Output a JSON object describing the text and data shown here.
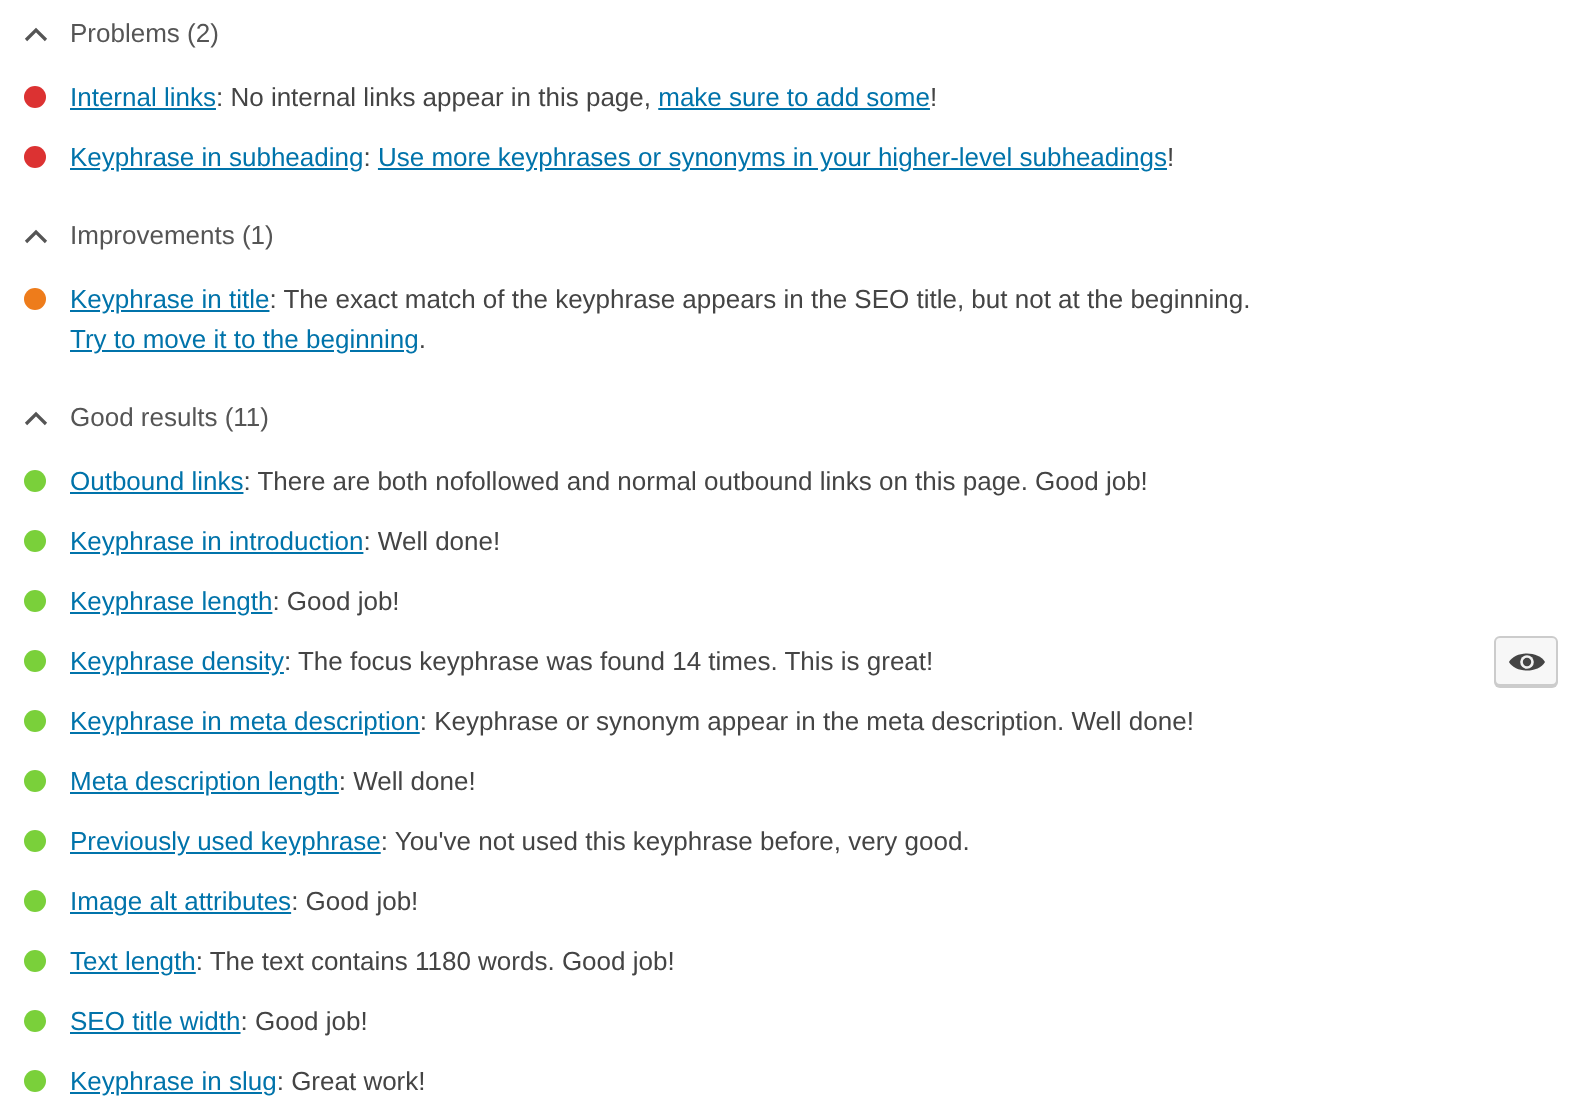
{
  "sections": [
    {
      "heading": "Problems (2)",
      "expanded": true,
      "items": [
        {
          "color": "#dc3232",
          "marker_button": false,
          "parts": [
            {
              "text": "Internal links",
              "link": true
            },
            {
              "text": ": No internal links appear in this page, ",
              "link": false
            },
            {
              "text": "make sure to add some",
              "link": true
            },
            {
              "text": "!",
              "link": false
            }
          ]
        },
        {
          "color": "#dc3232",
          "marker_button": false,
          "parts": [
            {
              "text": "Keyphrase in subheading",
              "link": true
            },
            {
              "text": ": ",
              "link": false
            },
            {
              "text": "Use more keyphrases or synonyms in your higher-level subheadings",
              "link": true
            },
            {
              "text": "!",
              "link": false
            }
          ]
        }
      ]
    },
    {
      "heading": "Improvements (1)",
      "expanded": true,
      "items": [
        {
          "color": "#ee7c1b",
          "marker_button": false,
          "parts": [
            {
              "text": "Keyphrase in title",
              "link": true
            },
            {
              "text": ": The exact match of the keyphrase appears in the SEO title, but not at the beginning. ",
              "link": false
            },
            {
              "text": "Try to move it to the beginning",
              "link": true
            },
            {
              "text": ".",
              "link": false
            }
          ]
        }
      ]
    },
    {
      "heading": "Good results (11)",
      "expanded": true,
      "items": [
        {
          "color": "#7ad03a",
          "marker_button": false,
          "parts": [
            {
              "text": "Outbound links",
              "link": true
            },
            {
              "text": ": There are both nofollowed and normal outbound links on this page. Good job!",
              "link": false
            }
          ]
        },
        {
          "color": "#7ad03a",
          "marker_button": false,
          "parts": [
            {
              "text": "Keyphrase in introduction",
              "link": true
            },
            {
              "text": ": Well done!",
              "link": false
            }
          ]
        },
        {
          "color": "#7ad03a",
          "marker_button": false,
          "parts": [
            {
              "text": "Keyphrase length",
              "link": true
            },
            {
              "text": ": Good job!",
              "link": false
            }
          ]
        },
        {
          "color": "#7ad03a",
          "marker_button": true,
          "parts": [
            {
              "text": "Keyphrase density",
              "link": true
            },
            {
              "text": ": The focus keyphrase was found 14 times. This is great!",
              "link": false
            }
          ]
        },
        {
          "color": "#7ad03a",
          "marker_button": false,
          "parts": [
            {
              "text": "Keyphrase in meta description",
              "link": true
            },
            {
              "text": ": Keyphrase or synonym appear in the meta description. Well done!",
              "link": false
            }
          ]
        },
        {
          "color": "#7ad03a",
          "marker_button": false,
          "parts": [
            {
              "text": "Meta description length",
              "link": true
            },
            {
              "text": ": Well done!",
              "link": false
            }
          ]
        },
        {
          "color": "#7ad03a",
          "marker_button": false,
          "parts": [
            {
              "text": "Previously used keyphrase",
              "link": true
            },
            {
              "text": ": You've not used this keyphrase before, very good.",
              "link": false
            }
          ]
        },
        {
          "color": "#7ad03a",
          "marker_button": false,
          "parts": [
            {
              "text": "Image alt attributes",
              "link": true
            },
            {
              "text": ": Good job!",
              "link": false
            }
          ]
        },
        {
          "color": "#7ad03a",
          "marker_button": false,
          "parts": [
            {
              "text": "Text length",
              "link": true
            },
            {
              "text": ": The text contains 1180 words. Good job!",
              "link": false
            }
          ]
        },
        {
          "color": "#7ad03a",
          "marker_button": false,
          "parts": [
            {
              "text": "SEO title width",
              "link": true
            },
            {
              "text": ": Good job!",
              "link": false
            }
          ]
        },
        {
          "color": "#7ad03a",
          "marker_button": false,
          "parts": [
            {
              "text": "Keyphrase in slug",
              "link": true
            },
            {
              "text": ": Great work!",
              "link": false
            }
          ]
        }
      ]
    }
  ]
}
